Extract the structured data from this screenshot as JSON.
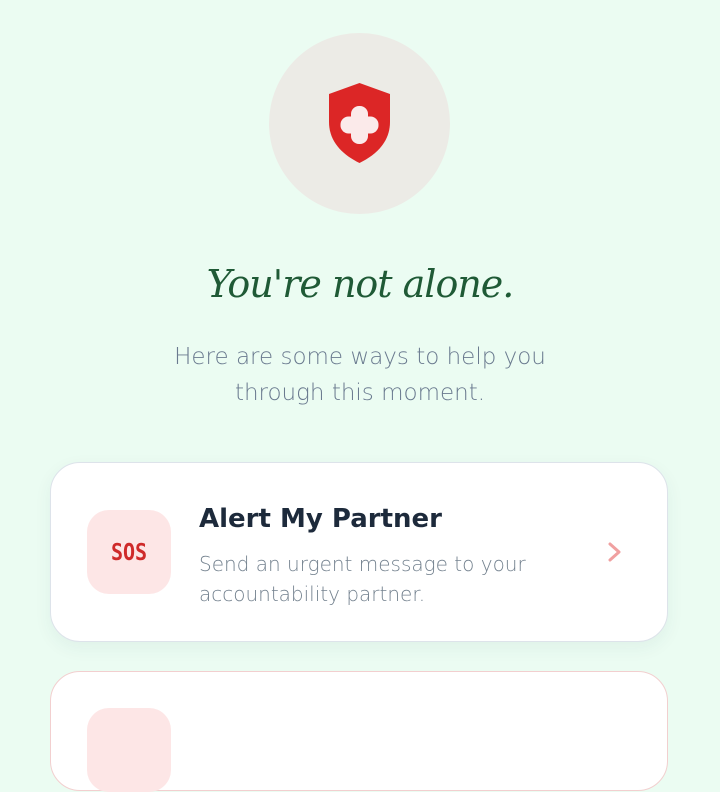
{
  "hero": {
    "icon": "shield-plus-icon",
    "icon_color": "#dc2626",
    "circle_color": "#ecebe6"
  },
  "headline": "You're not alone.",
  "subtitle": "Here are some ways to help you through this moment.",
  "colors": {
    "background": "#ebfcf2",
    "headline": "#1f5a36",
    "accent_red": "#cf2a2a",
    "icon_tile": "#fde6e6"
  },
  "cards": [
    {
      "icon": "sos-icon",
      "icon_label": "SOS",
      "title": "Alert My Partner",
      "description": "Send an urgent message to your accountability partner.",
      "chevron": "chevron-right-icon"
    },
    {
      "icon": "unknown-icon",
      "chevron": "chevron-right-icon"
    }
  ]
}
